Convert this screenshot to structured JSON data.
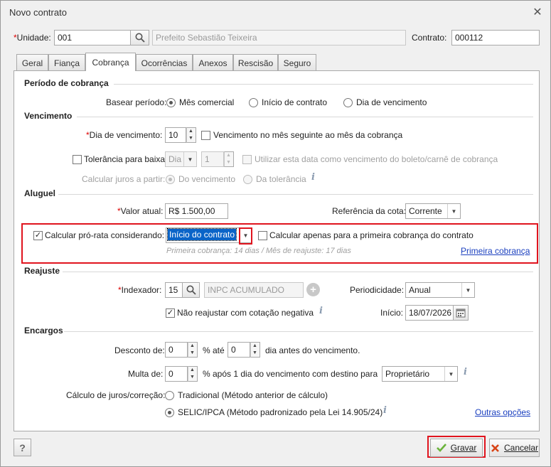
{
  "window": {
    "title": "Novo contrato",
    "close_glyph": "✕"
  },
  "header": {
    "unidade_label": "Unidade:",
    "unidade_value": "001",
    "unidade_name": "Prefeito Sebastião Teixeira",
    "contrato_label": "Contrato:",
    "contrato_value": "000112"
  },
  "tabs": [
    {
      "label": "Geral"
    },
    {
      "label": "Fiança"
    },
    {
      "label": "Cobrança",
      "active": true
    },
    {
      "label": "Ocorrências"
    },
    {
      "label": "Anexos"
    },
    {
      "label": "Rescisão"
    },
    {
      "label": "Seguro"
    }
  ],
  "periodo": {
    "title": "Período de cobrança",
    "basear_label": "Basear período:",
    "options": [
      "Mês comercial",
      "Início de contrato",
      "Dia de vencimento"
    ],
    "selected": "Mês comercial"
  },
  "vencimento": {
    "title": "Vencimento",
    "dia_label": "Dia de vencimento:",
    "dia_value": "10",
    "mes_seguinte_label": "Vencimento no mês seguinte ao mês da cobrança",
    "tolerancia_label": "Tolerância para baixa:",
    "tolerancia_type": "Dia",
    "tolerancia_value": "1",
    "utilizar_label": "Utilizar esta data como vencimento do boleto/carnê de cobrança",
    "juros_label": "Calcular juros a partir:",
    "juros_options": [
      "Do vencimento",
      "Da tolerância"
    ]
  },
  "aluguel": {
    "title": "Aluguel",
    "valor_label": "Valor atual:",
    "valor_value": "R$ 1.500,00",
    "referencia_label": "Referência da cota:",
    "referencia_value": "Corrente",
    "prorata_label": "Calcular pró-rata considerando:",
    "prorata_value": "Início do contrato",
    "apenas_label": "Calcular apenas para a primeira cobrança do contrato",
    "hint": "Primeira cobrança: 14 dias / Mês de reajuste: 17 dias",
    "primeira_link": "Primeira cobrança"
  },
  "reajuste": {
    "title": "Reajuste",
    "indexador_label": "Indexador:",
    "indexador_value": "15",
    "indexador_name": "INPC ACUMULADO",
    "periodicidade_label": "Periodicidade:",
    "periodicidade_value": "Anual",
    "nao_reajustar_label": "Não reajustar com cotação negativa",
    "inicio_label": "Início:",
    "inicio_value": "18/07/2026"
  },
  "encargos": {
    "title": "Encargos",
    "desconto_label": "Desconto de:",
    "desconto_value": "0",
    "ate_label": "% até",
    "ate_value": "0",
    "dia_antes_label": "dia antes do vencimento.",
    "multa_label": "Multa de:",
    "multa_value": "0",
    "apos_label": "% após 1 dia do vencimento  com destino para",
    "destino_value": "Proprietário",
    "juros_label": "Cálculo de juros/correção:",
    "opt_tradicional": "Tradicional (Método anterior de cálculo)",
    "opt_selic": "SELIC/IPCA (Método padronizado pela Lei 14.905/24)",
    "outras_link": "Outras opções"
  },
  "footer": {
    "help": "?",
    "gravar": "Gravar",
    "cancelar": "Cancelar"
  },
  "colors": {
    "highlight": "#e0141e",
    "link": "#1a3fbf",
    "select_bg": "#0a64c8"
  }
}
